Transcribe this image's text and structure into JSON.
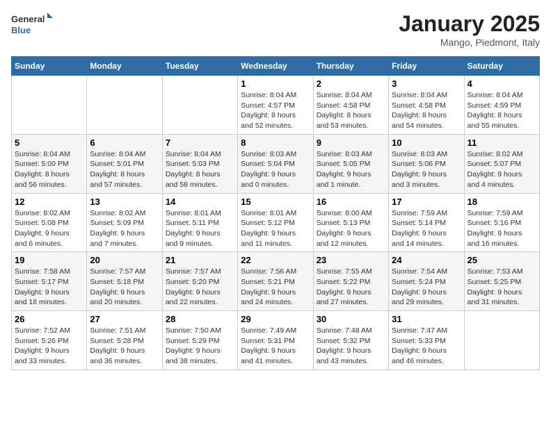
{
  "header": {
    "logo_line1": "General",
    "logo_line2": "Blue",
    "month": "January 2025",
    "location": "Mango, Piedmont, Italy"
  },
  "weekdays": [
    "Sunday",
    "Monday",
    "Tuesday",
    "Wednesday",
    "Thursday",
    "Friday",
    "Saturday"
  ],
  "weeks": [
    [
      {
        "day": "",
        "info": ""
      },
      {
        "day": "",
        "info": ""
      },
      {
        "day": "",
        "info": ""
      },
      {
        "day": "1",
        "info": "Sunrise: 8:04 AM\nSunset: 4:57 PM\nDaylight: 8 hours\nand 52 minutes."
      },
      {
        "day": "2",
        "info": "Sunrise: 8:04 AM\nSunset: 4:58 PM\nDaylight: 8 hours\nand 53 minutes."
      },
      {
        "day": "3",
        "info": "Sunrise: 8:04 AM\nSunset: 4:58 PM\nDaylight: 8 hours\nand 54 minutes."
      },
      {
        "day": "4",
        "info": "Sunrise: 8:04 AM\nSunset: 4:59 PM\nDaylight: 8 hours\nand 55 minutes."
      }
    ],
    [
      {
        "day": "5",
        "info": "Sunrise: 8:04 AM\nSunset: 5:00 PM\nDaylight: 8 hours\nand 56 minutes."
      },
      {
        "day": "6",
        "info": "Sunrise: 8:04 AM\nSunset: 5:01 PM\nDaylight: 8 hours\nand 57 minutes."
      },
      {
        "day": "7",
        "info": "Sunrise: 8:04 AM\nSunset: 5:03 PM\nDaylight: 8 hours\nand 58 minutes."
      },
      {
        "day": "8",
        "info": "Sunrise: 8:03 AM\nSunset: 5:04 PM\nDaylight: 9 hours\nand 0 minutes."
      },
      {
        "day": "9",
        "info": "Sunrise: 8:03 AM\nSunset: 5:05 PM\nDaylight: 9 hours\nand 1 minute."
      },
      {
        "day": "10",
        "info": "Sunrise: 8:03 AM\nSunset: 5:06 PM\nDaylight: 9 hours\nand 3 minutes."
      },
      {
        "day": "11",
        "info": "Sunrise: 8:02 AM\nSunset: 5:07 PM\nDaylight: 9 hours\nand 4 minutes."
      }
    ],
    [
      {
        "day": "12",
        "info": "Sunrise: 8:02 AM\nSunset: 5:08 PM\nDaylight: 9 hours\nand 6 minutes."
      },
      {
        "day": "13",
        "info": "Sunrise: 8:02 AM\nSunset: 5:09 PM\nDaylight: 9 hours\nand 7 minutes."
      },
      {
        "day": "14",
        "info": "Sunrise: 8:01 AM\nSunset: 5:11 PM\nDaylight: 9 hours\nand 9 minutes."
      },
      {
        "day": "15",
        "info": "Sunrise: 8:01 AM\nSunset: 5:12 PM\nDaylight: 9 hours\nand 11 minutes."
      },
      {
        "day": "16",
        "info": "Sunrise: 8:00 AM\nSunset: 5:13 PM\nDaylight: 9 hours\nand 12 minutes."
      },
      {
        "day": "17",
        "info": "Sunrise: 7:59 AM\nSunset: 5:14 PM\nDaylight: 9 hours\nand 14 minutes."
      },
      {
        "day": "18",
        "info": "Sunrise: 7:59 AM\nSunset: 5:16 PM\nDaylight: 9 hours\nand 16 minutes."
      }
    ],
    [
      {
        "day": "19",
        "info": "Sunrise: 7:58 AM\nSunset: 5:17 PM\nDaylight: 9 hours\nand 18 minutes."
      },
      {
        "day": "20",
        "info": "Sunrise: 7:57 AM\nSunset: 5:18 PM\nDaylight: 9 hours\nand 20 minutes."
      },
      {
        "day": "21",
        "info": "Sunrise: 7:57 AM\nSunset: 5:20 PM\nDaylight: 9 hours\nand 22 minutes."
      },
      {
        "day": "22",
        "info": "Sunrise: 7:56 AM\nSunset: 5:21 PM\nDaylight: 9 hours\nand 24 minutes."
      },
      {
        "day": "23",
        "info": "Sunrise: 7:55 AM\nSunset: 5:22 PM\nDaylight: 9 hours\nand 27 minutes."
      },
      {
        "day": "24",
        "info": "Sunrise: 7:54 AM\nSunset: 5:24 PM\nDaylight: 9 hours\nand 29 minutes."
      },
      {
        "day": "25",
        "info": "Sunrise: 7:53 AM\nSunset: 5:25 PM\nDaylight: 9 hours\nand 31 minutes."
      }
    ],
    [
      {
        "day": "26",
        "info": "Sunrise: 7:52 AM\nSunset: 5:26 PM\nDaylight: 9 hours\nand 33 minutes."
      },
      {
        "day": "27",
        "info": "Sunrise: 7:51 AM\nSunset: 5:28 PM\nDaylight: 9 hours\nand 36 minutes."
      },
      {
        "day": "28",
        "info": "Sunrise: 7:50 AM\nSunset: 5:29 PM\nDaylight: 9 hours\nand 38 minutes."
      },
      {
        "day": "29",
        "info": "Sunrise: 7:49 AM\nSunset: 5:31 PM\nDaylight: 9 hours\nand 41 minutes."
      },
      {
        "day": "30",
        "info": "Sunrise: 7:48 AM\nSunset: 5:32 PM\nDaylight: 9 hours\nand 43 minutes."
      },
      {
        "day": "31",
        "info": "Sunrise: 7:47 AM\nSunset: 5:33 PM\nDaylight: 9 hours\nand 46 minutes."
      },
      {
        "day": "",
        "info": ""
      }
    ]
  ]
}
